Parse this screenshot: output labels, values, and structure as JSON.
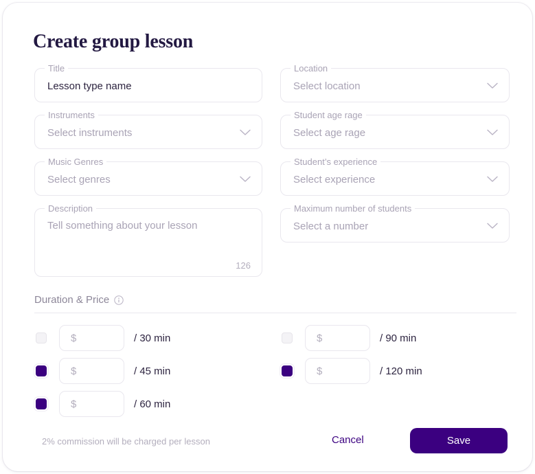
{
  "dialog": {
    "title": "Create group lesson"
  },
  "fields": {
    "title": {
      "label": "Title",
      "value": "Lesson type name"
    },
    "location": {
      "label": "Location",
      "placeholder": "Select location",
      "icon": "chevron-down-icon"
    },
    "instruments": {
      "label": "Instruments",
      "placeholder": "Select instruments",
      "icon": "chevron-down-icon"
    },
    "age_range": {
      "label": "Student age rage",
      "placeholder": "Select age rage",
      "icon": "chevron-down-icon"
    },
    "genres": {
      "label": "Music Genres",
      "placeholder": "Select genres",
      "icon": "chevron-down-icon"
    },
    "experience": {
      "label": "Student’s experience",
      "placeholder": "Select experience",
      "icon": "chevron-down-icon"
    },
    "description": {
      "label": "Description",
      "placeholder": "Tell something about your lesson",
      "counter": "126"
    },
    "max_students": {
      "label": "Maximum number of students",
      "placeholder": "Select a number",
      "icon": "chevron-down-icon"
    }
  },
  "duration_section": {
    "title": "Duration & Price",
    "info_icon": "info-icon",
    "rows": [
      {
        "checked": false,
        "price": "",
        "currency": "$",
        "label": "/ 30 min"
      },
      {
        "checked": true,
        "price": "",
        "currency": "$",
        "label": "/ 45 min"
      },
      {
        "checked": true,
        "price": "",
        "currency": "$",
        "label": "/ 60 min"
      },
      {
        "checked": false,
        "price": "",
        "currency": "$",
        "label": "/ 90 min"
      },
      {
        "checked": true,
        "price": "",
        "currency": "$",
        "label": "/ 120 min"
      }
    ]
  },
  "footer": {
    "commission_note": "2% commission will be charged per lesson",
    "cancel_label": "Cancel",
    "save_label": "Save"
  },
  "colors": {
    "accent": "#3b0080",
    "heading": "#231942",
    "muted": "#a9a3b5",
    "border": "#e9e7ee"
  }
}
